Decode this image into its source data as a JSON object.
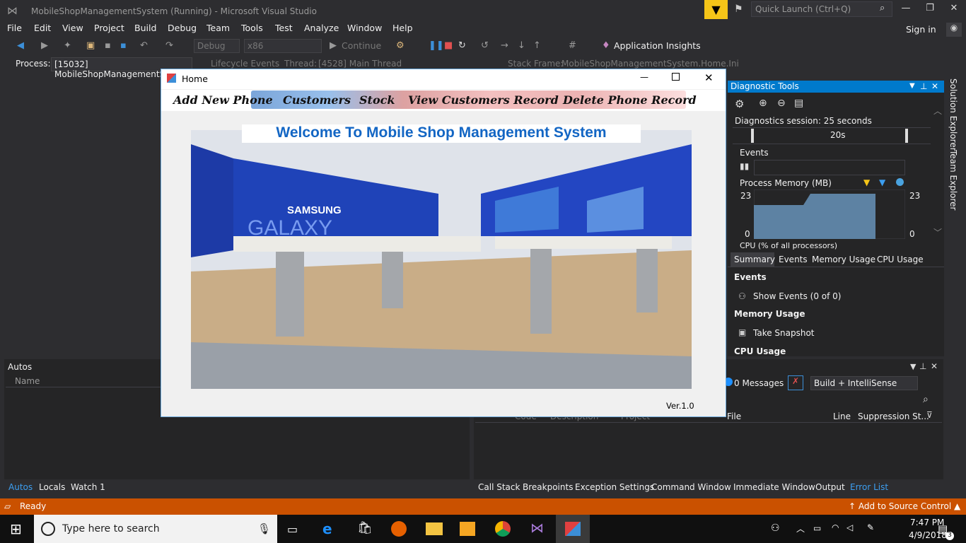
{
  "window": {
    "title": "MobileShopManagementSystem (Running) - Microsoft Visual Studio"
  },
  "quick_launch": {
    "placeholder": "Quick Launch (Ctrl+Q)"
  },
  "menu": [
    "File",
    "Edit",
    "View",
    "Project",
    "Build",
    "Debug",
    "Team",
    "Tools",
    "Test",
    "Analyze",
    "Window",
    "Help"
  ],
  "account": {
    "sign_in": "Sign in"
  },
  "toolbar": {
    "config": "Debug",
    "platform": "x86",
    "continue": "Continue",
    "insights": "Application Insights"
  },
  "debug_bar": {
    "process_label": "Process:",
    "process_value": "[15032] MobileShopManagementS",
    "lifecycle": "Lifecycle Events",
    "thread_label": "Thread:",
    "thread_value": "[4528] Main Thread",
    "stack_label": "Stack Frame:",
    "stack_value": "MobileShopManagementSystem.Home.Ini"
  },
  "home": {
    "title": "Home",
    "menu": [
      "Add New Phone",
      "Customers",
      "Stock",
      "View Customers Record",
      "Delete Phone Record"
    ],
    "welcome": "Welcome To Mobile Shop Management System",
    "version": "Ver.1.0",
    "image_text": {
      "brand": "SAMSUNG",
      "line": "GALAXY"
    }
  },
  "diagnostics": {
    "title": "Diagnostic Tools",
    "session": "Diagnostics session: 25 seconds",
    "timeline_label": "20s",
    "events": "Events",
    "process_memory": "Process Memory (MB)",
    "mem_max": "23",
    "mem_min": "0",
    "cpu": "CPU (% of all processors)",
    "tabs": [
      "Summary",
      "Events",
      "Memory Usage",
      "CPU Usage"
    ],
    "summary": {
      "events_heading": "Events",
      "show_events": "Show Events (0 of 0)",
      "memory_heading": "Memory Usage",
      "take_snapshot": "Take Snapshot",
      "cpu_heading": "CPU Usage"
    }
  },
  "side_tabs": [
    "Solution Explorer",
    "Team Explorer"
  ],
  "autos": {
    "title": "Autos",
    "col_name": "Name"
  },
  "error_list": {
    "messages": "0 Messages",
    "filter": "Build + IntelliSense",
    "columns": [
      "Code",
      "Description",
      "Project",
      "File",
      "Line",
      "Suppression St..."
    ]
  },
  "bottom_left_tabs": [
    "Autos",
    "Locals",
    "Watch 1"
  ],
  "bottom_right_tabs": [
    "Call Stack",
    "Breakpoints",
    "Exception Settings",
    "Command Window",
    "Immediate Window",
    "Output",
    "Error List"
  ],
  "status": {
    "text": "Ready",
    "source_control": "Add to Source Control"
  },
  "taskbar": {
    "search": "Type here to search",
    "time": "7:47 PM",
    "date": "4/9/2018",
    "notifications": "3"
  }
}
